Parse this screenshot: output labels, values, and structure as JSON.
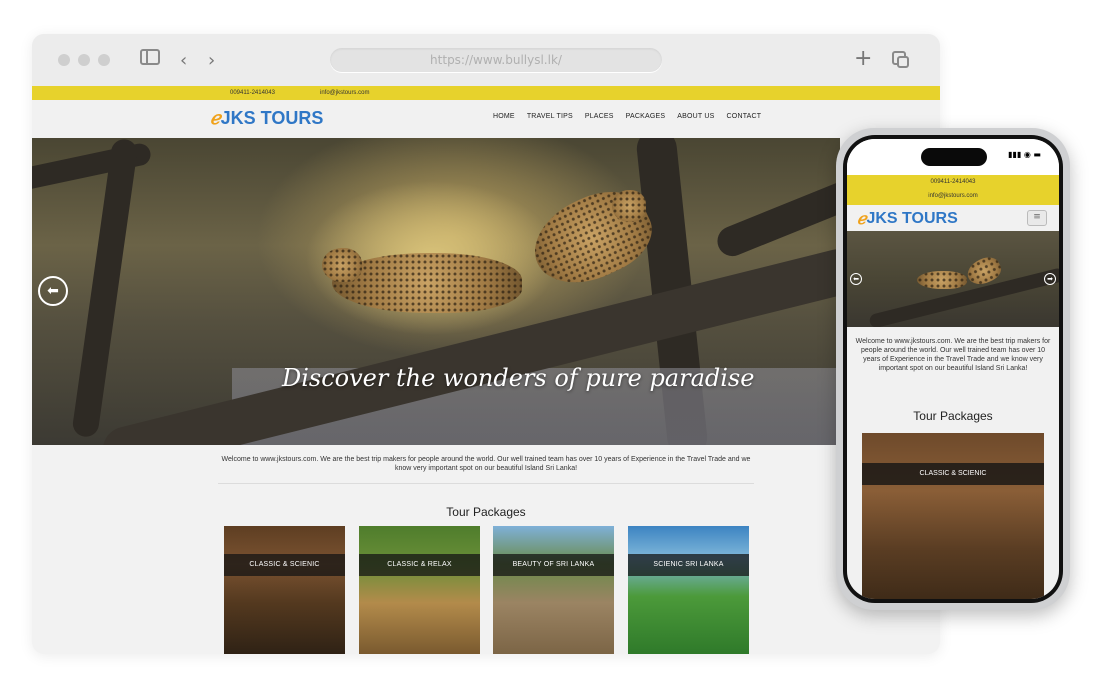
{
  "browser": {
    "url": "https://www.bullysl.lk/"
  },
  "site": {
    "phone": "009411-2414043",
    "email": "info@jkstours.com",
    "logo_text": "JKS TOURS",
    "nav": [
      "HOME",
      "TRAVEL TIPS",
      "PLACES",
      "PACKAGES",
      "ABOUT US",
      "CONTACT"
    ],
    "hero_caption": "Discover the wonders of pure paradise",
    "welcome": "Welcome to www.jkstours.com. We are the best trip makers for people around the world. Our well trained team has over 10 years of Experience in the Travel Trade and we know very important spot on our beautiful Island Sri Lanka!",
    "section_title": "Tour Packages",
    "packages": [
      "CLASSIC & SCIENIC",
      "CLASSIC & RELAX",
      "BEAUTY OF SRI LANKA",
      "SCIENIC SRI LANKA"
    ]
  },
  "mobile": {
    "phone": "009411-2414043",
    "email": "info@jkstours.com",
    "logo_text": "JKS TOURS",
    "welcome": "Welcome to www.jkstours.com. We are the best trip makers for people around the world. Our well trained team has over 10 years of Experience in the Travel Trade and we know very important spot on our beautiful Island Sri Lanka!",
    "section_title": "Tour Packages",
    "package": "CLASSIC & SCIENIC"
  },
  "colors": {
    "accent_yellow": "#e7d22c",
    "logo_blue": "#2f77c6",
    "logo_orange": "#f0a21b"
  }
}
